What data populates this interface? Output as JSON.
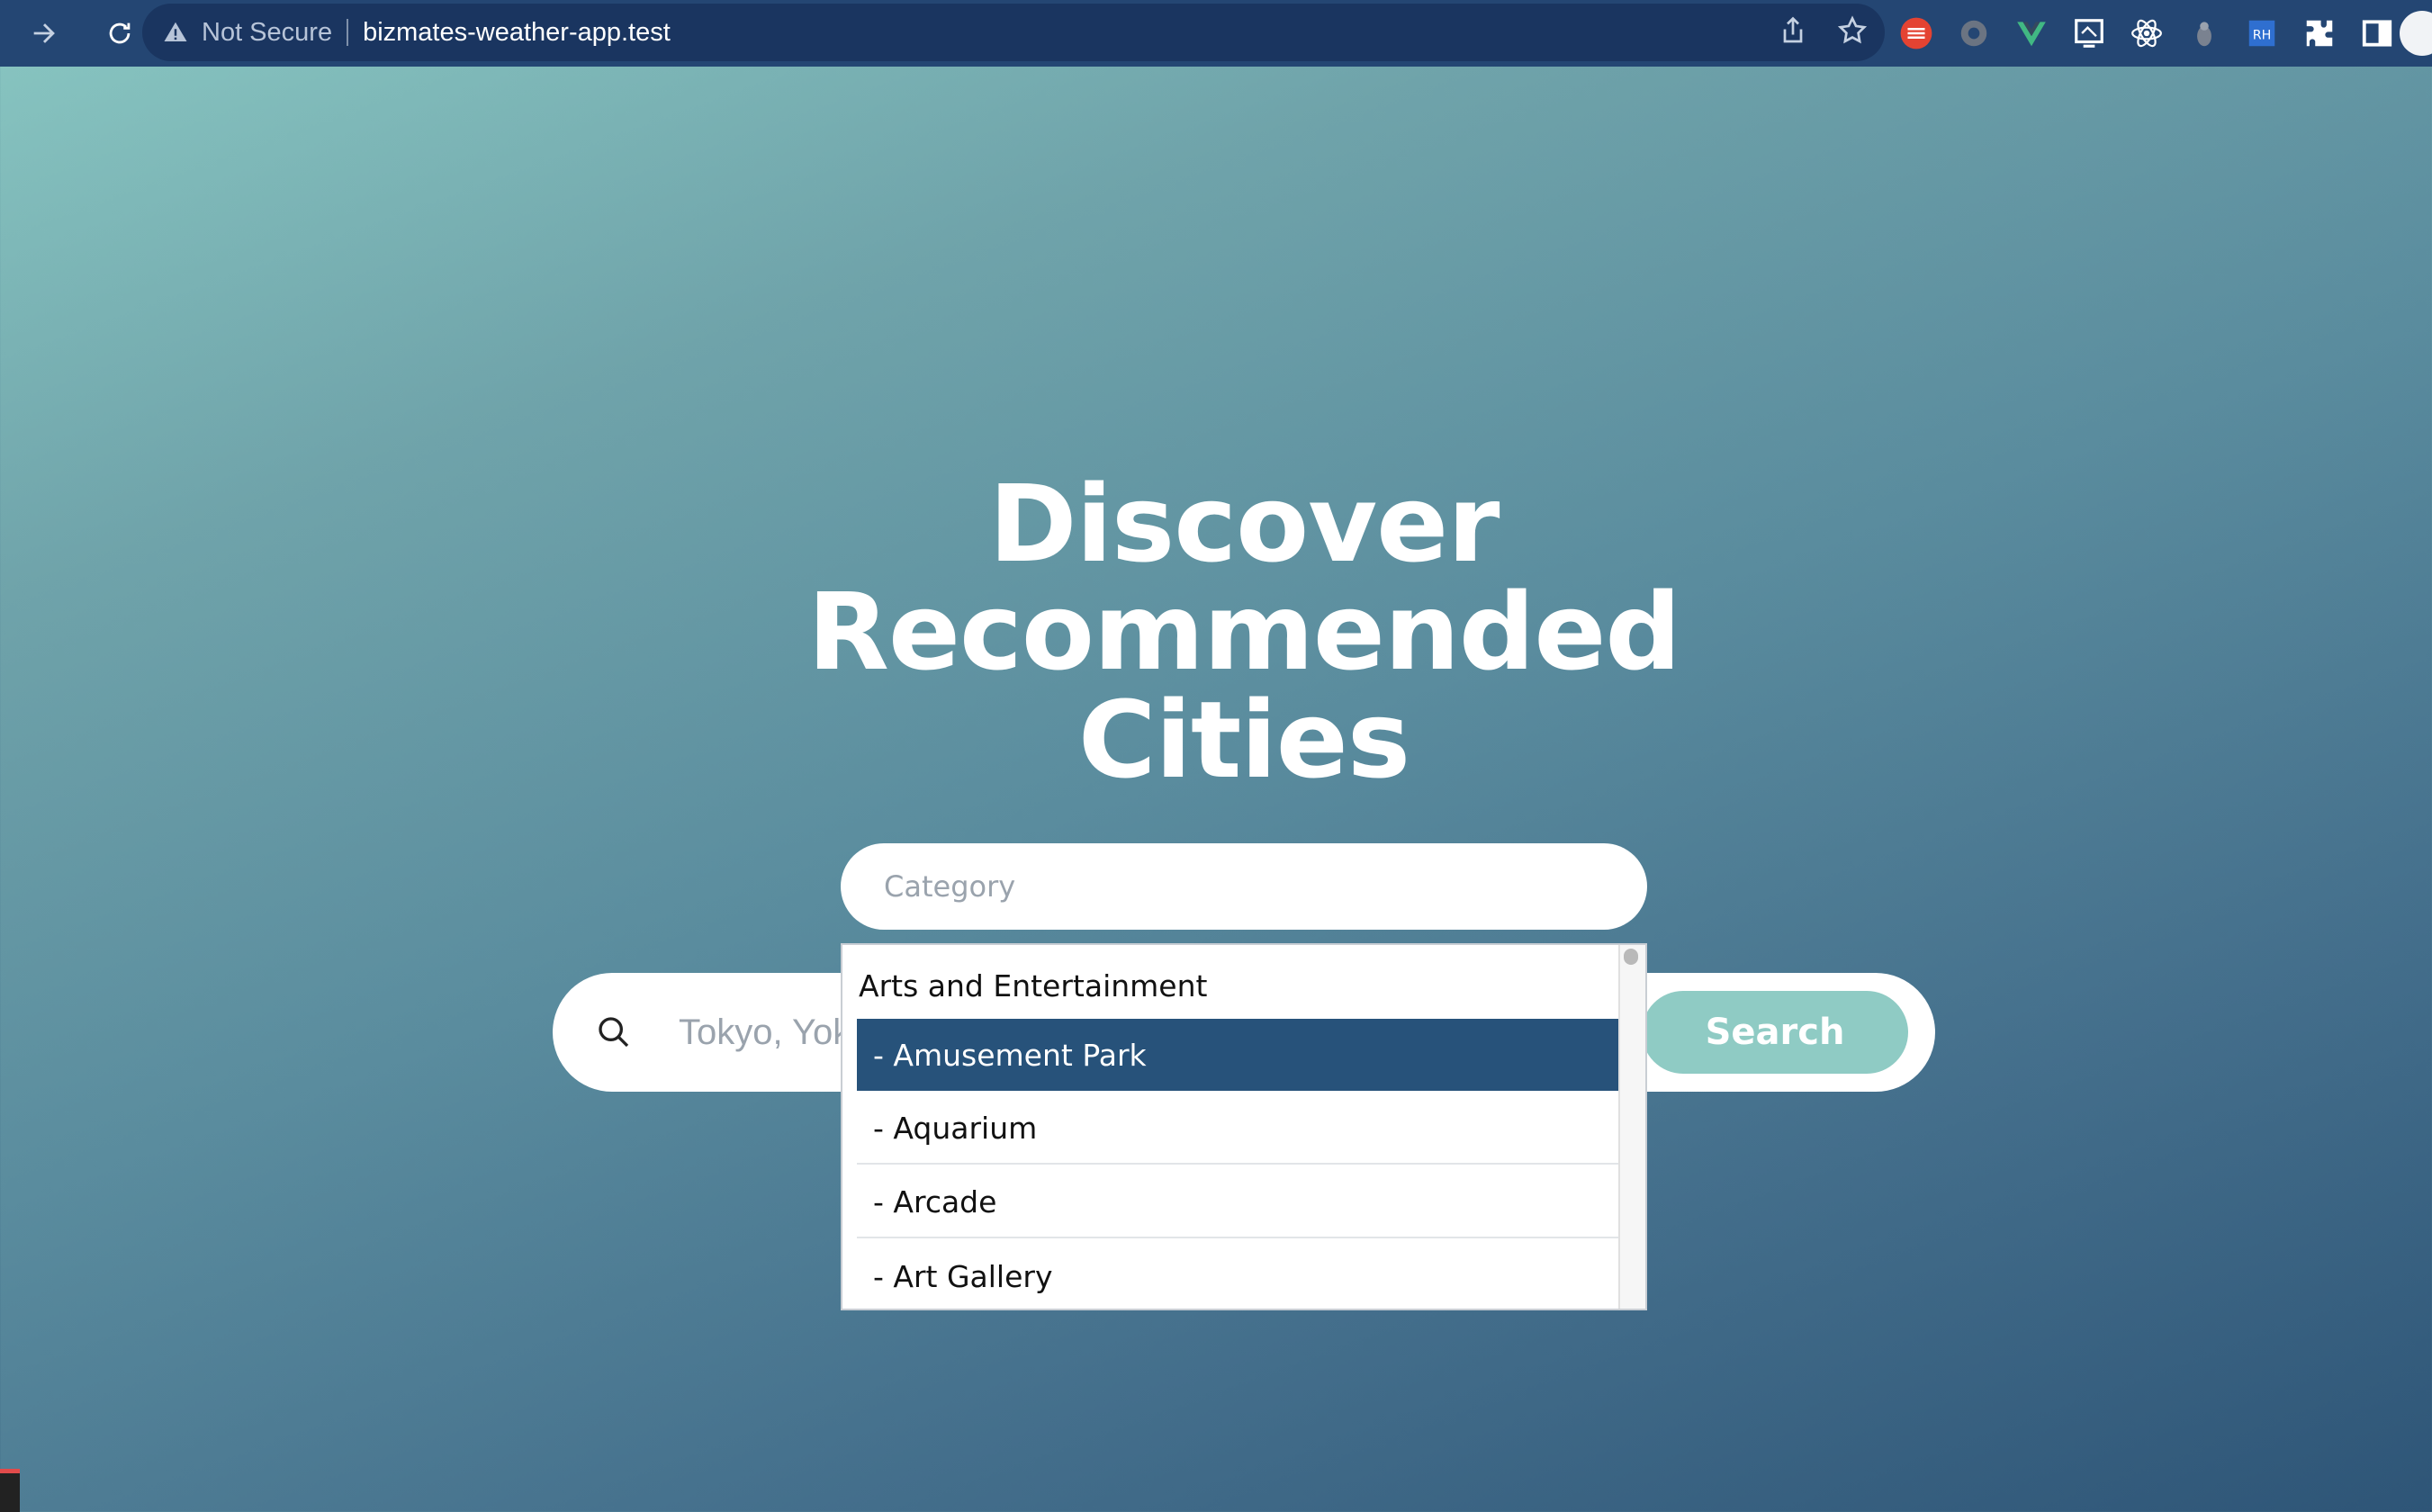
{
  "browser": {
    "security_label": "Not Secure",
    "url": "bizmates-weather-app.test",
    "icons": [
      "forward-icon",
      "reload-icon",
      "warning-icon",
      "share-icon",
      "bookmark-star-icon",
      "extension-todoist-icon",
      "extension-gear-icon",
      "extension-vue-devtools-icon",
      "extension-screen-icon",
      "extension-react-devtools-icon",
      "extension-pin-icon",
      "extension-rh-icon",
      "extensions-puzzle-icon",
      "side-panel-icon",
      "profile-avatar"
    ]
  },
  "hero": {
    "line1": "Discover",
    "line2": "Recommended",
    "line3": "Cities"
  },
  "category": {
    "placeholder": "Category"
  },
  "search": {
    "placeholder": "Tokyo, Yokohama",
    "button_label": "Search"
  },
  "dropdown": {
    "group": "Arts and Entertainment",
    "options": [
      {
        "label": "- Amusement Park",
        "selected": true
      },
      {
        "label": "- Aquarium",
        "selected": false
      },
      {
        "label": "- Arcade",
        "selected": false
      },
      {
        "label": "- Art Gallery",
        "selected": false
      }
    ]
  },
  "colors": {
    "browser_bar": "#244673",
    "selected_option": "#27527a",
    "search_button": "#8fcbc4"
  }
}
